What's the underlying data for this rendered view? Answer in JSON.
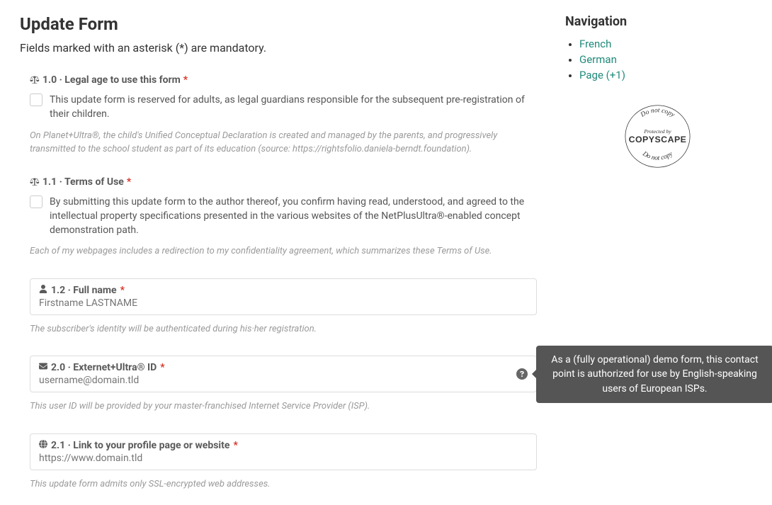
{
  "page": {
    "title": "Update Form",
    "mandatory_note": "Fields marked with an asterisk (*) are mandatory."
  },
  "fields": {
    "f1_0": {
      "label": "1.0 · Legal age to use this form",
      "required": "*",
      "text": "This update form is reserved for adults, as legal guardians responsible for the subsequent pre-registration of their children.",
      "help": "On Planet+Ultra®, the child's Unified Conceptual Declaration is created and managed by the parents, and progressively transmitted to the school student as part of its education (source: https://rightsfolio.daniela-berndt.foundation)."
    },
    "f1_1": {
      "label": "1.1 · Terms of Use",
      "required": "*",
      "text": "By submitting this update form to the author thereof, you confirm having read, understood, and agreed to the intellectual property specifications presented in the various websites of the NetPlusUltra®-enabled concept demonstration path.",
      "help": "Each of my webpages includes a redirection to my confidentiality agreement, which summarizes these Terms of Use."
    },
    "f1_2": {
      "label": "1.2 · Full name",
      "required": "*",
      "placeholder": "Firstname LASTNAME",
      "help": "The subscriber's identity will be authenticated during his·her registration."
    },
    "f2_0": {
      "label": "2.0 · Externet+Ultra® ID",
      "required": "*",
      "placeholder": "username@domain.tld",
      "help": "This user ID will be provided by your master-franchised Internet Service Provider (ISP)."
    },
    "f2_1": {
      "label": "2.1 · Link to your profile page or website",
      "required": "*",
      "placeholder": "https://www.domain.tld",
      "help": "This update form admits only SSL-encrypted web addresses."
    }
  },
  "tooltip": {
    "text": "As a (fully operational) demo form, this contact point is authorized for use by English-speaking users of European ISPs."
  },
  "sidebar": {
    "title": "Navigation",
    "items": [
      {
        "label": "French"
      },
      {
        "label": "German"
      },
      {
        "label": "Page (+1)"
      }
    ],
    "copyscape": {
      "top": "Do not copy",
      "middle": "Protected by",
      "brand": "COPYSCAPE",
      "bottom": "Do not copy"
    }
  }
}
